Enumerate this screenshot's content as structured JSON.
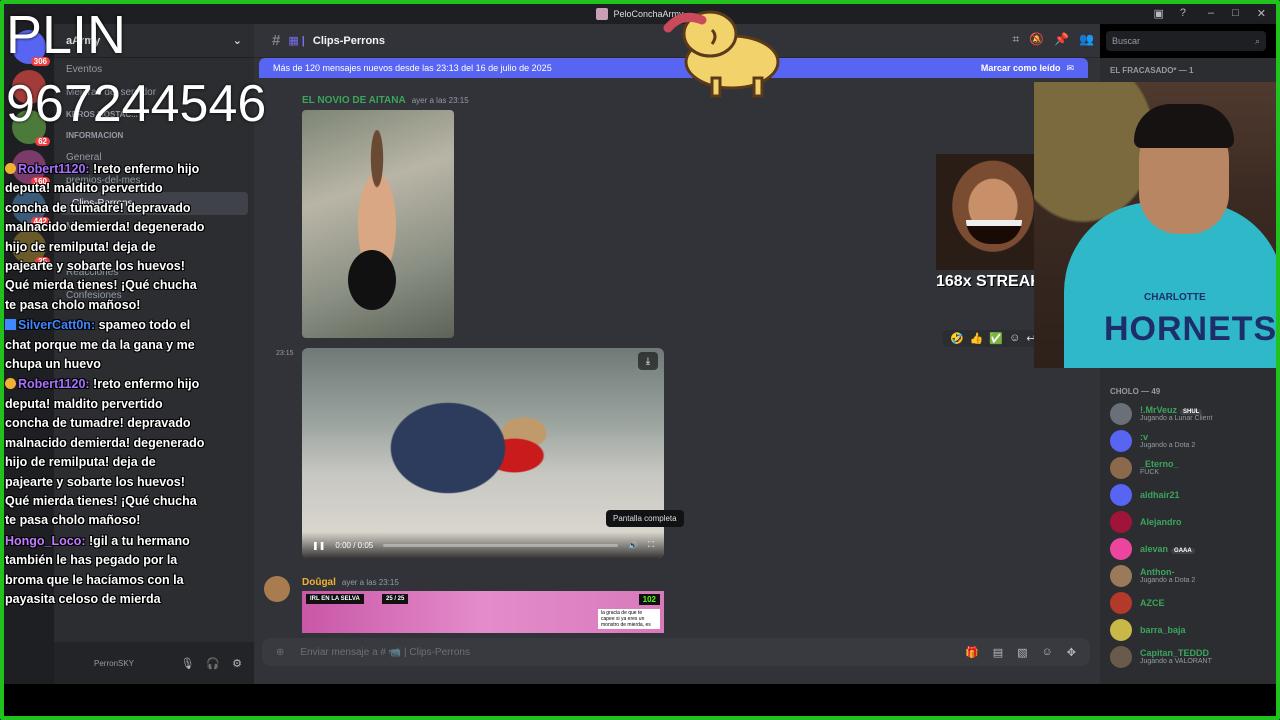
{
  "titlebar": {
    "title": "PeloConchaArmy"
  },
  "server_header": {
    "name": "aArmy"
  },
  "channels": [
    {
      "label": "Eventos",
      "category": false
    },
    {
      "label": "Mejoras del servidor",
      "category": false
    },
    {
      "label": "KBROS MOSTAC...",
      "category": true
    },
    {
      "label": "INFORMACION",
      "category": true
    },
    {
      "label": "General",
      "category": false
    },
    {
      "label": "premios-del-mes",
      "category": false
    },
    {
      "label": "Clips-Perrons",
      "category": false,
      "active": true
    },
    {
      "label": "Musica",
      "category": false
    },
    {
      "label": "streams",
      "category": false
    },
    {
      "label": "Reacciones",
      "category": false
    },
    {
      "label": "Confesiones",
      "category": false
    }
  ],
  "server_badges": [
    "306",
    "62",
    "160",
    "442",
    "25"
  ],
  "user_panel": {
    "name": "PerronSKY"
  },
  "main": {
    "channel_name": "Clips-Perrons",
    "search_placeholder": "Buscar",
    "banner_text": "Más de 120 mensajes nuevos desde las 23:13 del 16 de julio de 2025",
    "banner_action": "Marcar como leído",
    "msg1_author": "EL NOVIO DE AITANA",
    "msg1_time": "ayer a las 23:15",
    "video_time_side": "23:15",
    "video_time": "0:00 / 0:05",
    "video_progress": 0.0,
    "tooltip": "Pantalla completa",
    "msg2_author": "Doûgal",
    "msg2_time": "ayer a las 23:15",
    "img2_tag": "IRL EN LA SELVA",
    "img2_count": "25 / 25",
    "img2_kick": "102",
    "img2_caption": "la gracia de que te capee si ya eres un monstro de mierda, es",
    "composer_placeholder": "Enviar mensaje a # 📹 | Clips-Perrons"
  },
  "members": {
    "category_top": "EL FRACASADO* — 1",
    "category": "CHOLO — 49",
    "list": [
      {
        "name": "!.MrVeuz",
        "tag": "SHUL",
        "status": "Jugando a Lunar Client"
      },
      {
        "name": ":v",
        "tag": "",
        "status": "Jugando a Dota 2"
      },
      {
        "name": "_Eterno_",
        "tag": "",
        "status": "FUCK"
      },
      {
        "name": "aldhair21",
        "tag": "",
        "status": ""
      },
      {
        "name": "Alejandro",
        "tag": "",
        "status": ""
      },
      {
        "name": "alevan",
        "tag": "GAAA",
        "status": ""
      },
      {
        "name": "Anthon-",
        "tag": "",
        "status": "Jugando a Dota 2"
      },
      {
        "name": "AZCE",
        "tag": "",
        "status": ""
      },
      {
        "name": "barra_baja",
        "tag": "",
        "status": ""
      },
      {
        "name": "Capitan_TEDDD",
        "tag": "",
        "status": "Jugando a VALORANT"
      }
    ]
  },
  "overlay": {
    "plin": "PLIN",
    "phone": "967244546",
    "streak": "168x STREAK",
    "cam_text": "HORNETS",
    "cam_text2": "CHARLOTTE"
  },
  "chat": [
    {
      "user": "Robert1120:",
      "color_class": "u1",
      "icon": "y",
      "text": " !reto enfermo hijo deputa! maldito pervertido concha de tumadre! depravado malnacido demierda! degenerado hijo de remilputa! deja de pajearte y sobarte los huevos! Qué mierda tienes! ¡Qué chucha te pasa cholo mañoso!"
    },
    {
      "user": "SilverCatt0n:",
      "color_class": "u2",
      "icon": "b",
      "text": " spameo todo el chat porque me da la gana y me chupa un huevo"
    },
    {
      "user": "Robert1120:",
      "color_class": "u1",
      "icon": "y",
      "text": " !reto enfermo hijo deputa! maldito pervertido concha de tumadre! depravado malnacido demierda! degenerado hijo de remilputa! deja de pajearte y sobarte los huevos! Qué mierda tienes! ¡Qué chucha te pasa cholo mañoso!"
    },
    {
      "user": "Hongo_Loco:",
      "color_class": "u3",
      "icon": "",
      "text": " !gil a tu hermano también le has pegado por la broma que le hacíamos con la payasita celoso de mierda"
    }
  ],
  "colors": {
    "accent": "#5865f2",
    "stream_border": "#22c21e",
    "online": "#3ba55c"
  }
}
